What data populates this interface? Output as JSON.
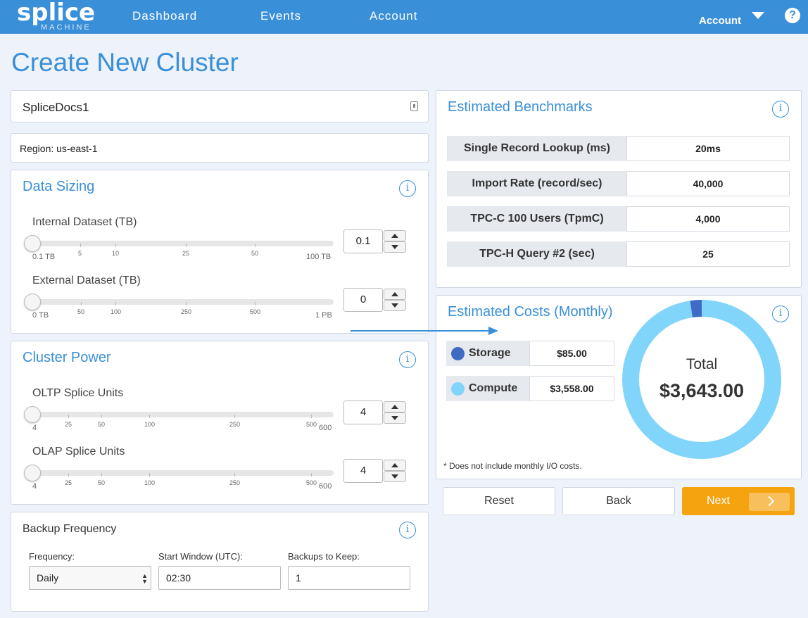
{
  "header": {
    "logo_word": "splice",
    "logo_sub": "MACHINE",
    "nav": [
      "Dashboard",
      "Events",
      "Account"
    ],
    "account_menu": "Account",
    "help_glyph": "?"
  },
  "page": {
    "title": "Create New Cluster"
  },
  "cluster_name": {
    "value": "SpliceDocs1"
  },
  "region": {
    "text": "Region: us-east-1"
  },
  "data_sizing": {
    "title": "Data Sizing",
    "internal": {
      "label": "Internal Dataset (TB)",
      "value": "0.1",
      "ticks": [
        "5",
        "10",
        "25",
        "50"
      ],
      "min_label": "0.1 TB",
      "max_label": "100 TB"
    },
    "external": {
      "label": "External Dataset (TB)",
      "value": "0",
      "ticks": [
        "50",
        "100",
        "250",
        "500"
      ],
      "min_label": "0 TB",
      "max_label": "1 PB"
    }
  },
  "cluster_power": {
    "title": "Cluster Power",
    "oltp": {
      "label": "OLTP Splice Units",
      "value": "4",
      "ticks": [
        "25",
        "50",
        "100",
        "250",
        "500"
      ],
      "min_label": "4",
      "max_label": "600"
    },
    "olap": {
      "label": "OLAP Splice Units",
      "value": "4",
      "ticks": [
        "25",
        "50",
        "100",
        "250",
        "500"
      ],
      "min_label": "4",
      "max_label": "600"
    }
  },
  "backup": {
    "title": "Backup Frequency",
    "frequency_label": "Frequency:",
    "frequency_value": "Daily",
    "window_label": "Start Window (UTC):",
    "window_value": "02:30",
    "keep_label": "Backups to Keep:",
    "keep_value": "1"
  },
  "benchmarks": {
    "title": "Estimated Benchmarks",
    "rows": [
      {
        "label": "Single Record Lookup (ms)",
        "value": "20ms"
      },
      {
        "label": "Import Rate (record/sec)",
        "value": "40,000"
      },
      {
        "label": "TPC-C 100 Users (TpmC)",
        "value": "4,000"
      },
      {
        "label": "TPC-H Query #2 (sec)",
        "value": "25"
      }
    ]
  },
  "costs": {
    "title": "Estimated Costs (Monthly)",
    "rows": [
      {
        "label": "Storage",
        "value": "$85.00",
        "color": "#3f6bc4"
      },
      {
        "label": "Compute",
        "value": "$3,558.00",
        "color": "#81d4fa"
      }
    ],
    "total_label": "Total",
    "total_value": "$3,643.00",
    "donut": {
      "storage": 85.0,
      "compute": 3558.0
    },
    "footnote": "* Does not include monthly I/O costs."
  },
  "actions": {
    "reset": "Reset",
    "back": "Back",
    "next": "Next"
  },
  "colors": {
    "accent": "#3a8fd9",
    "next": "#f5a30f"
  },
  "icons": [
    "info-icon",
    "help-icon",
    "caret-down-icon",
    "lock-icon",
    "chevron-right-icon"
  ]
}
